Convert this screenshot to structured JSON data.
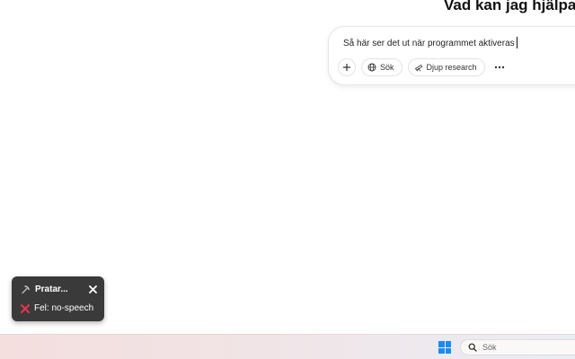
{
  "heading": "Vad kan jag hjälpa",
  "composer": {
    "text": "Så här ser det ut när programmet aktiveras",
    "buttons": {
      "add_icon": "plus-icon",
      "search_label": "Sök",
      "deep_research_label": "Djup research",
      "more_icon": "more-dots-icon"
    }
  },
  "toast": {
    "title": "Pratar...",
    "status_text": "Fel: no-speech",
    "colors": {
      "error": "#e8344f",
      "background": "#3a3a3a"
    }
  },
  "taskbar": {
    "search_placeholder": "Sök",
    "start_icon": "windows-logo-icon"
  }
}
